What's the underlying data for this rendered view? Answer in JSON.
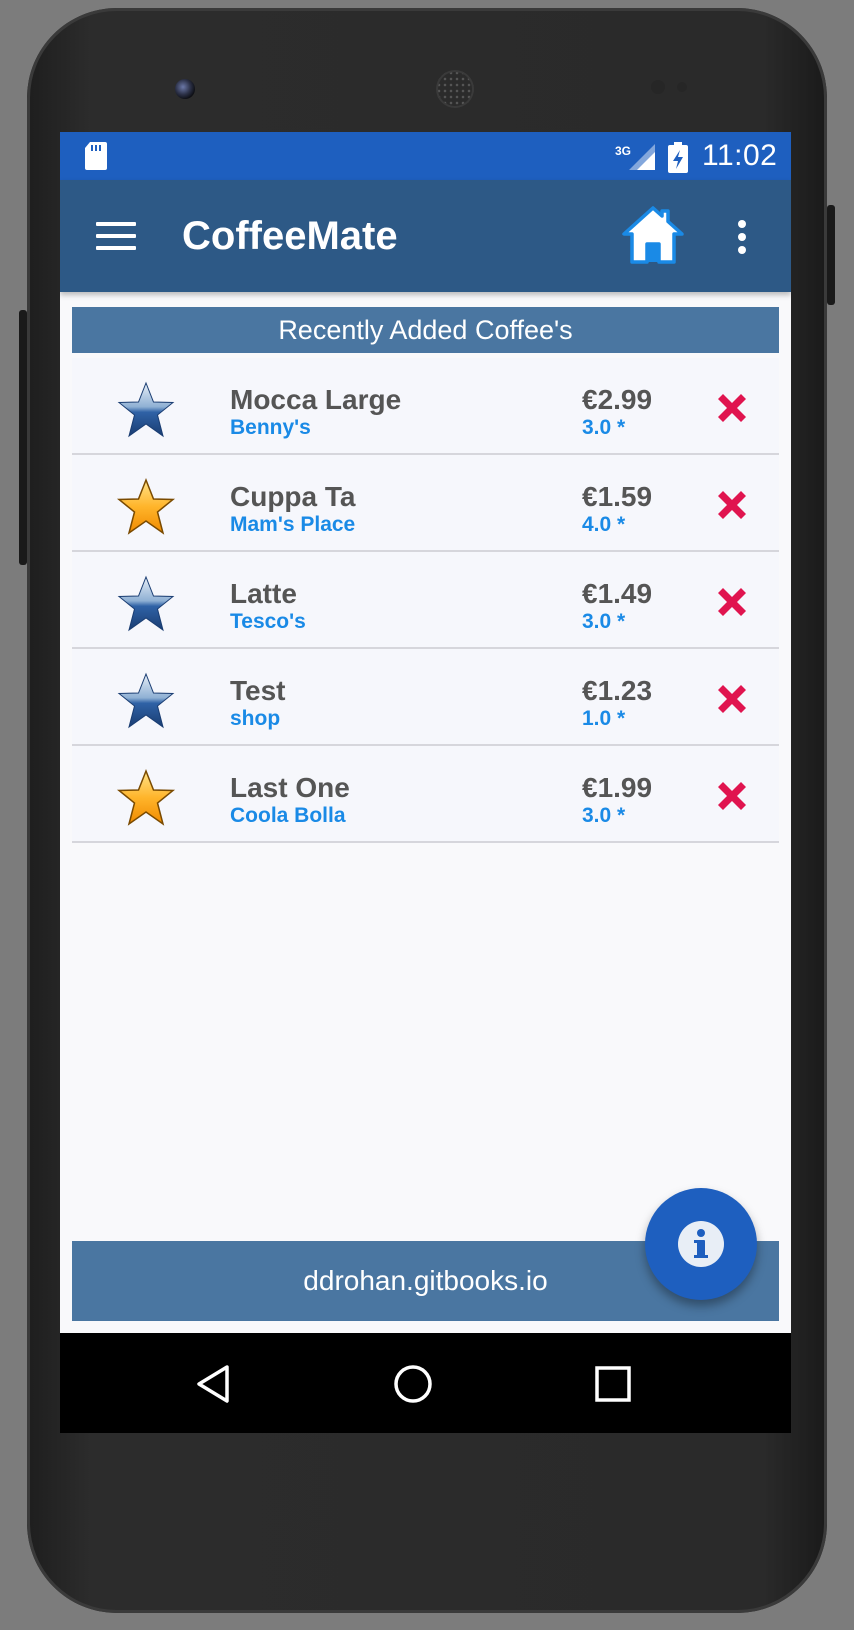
{
  "status_bar": {
    "network": "3G",
    "time": "11:02"
  },
  "app_bar": {
    "title": "CoffeeMate",
    "menu_icon": "hamburger-menu-icon",
    "home_icon": "home-icon",
    "overflow_icon": "more-vert-icon"
  },
  "section": {
    "title": "Recently Added Coffee's"
  },
  "coffees": [
    {
      "name": "Mocca Large",
      "shop": "Benny's",
      "price": "€2.99",
      "rating": "3.0 *",
      "favourite": false
    },
    {
      "name": "Cuppa Ta",
      "shop": "Mam's Place",
      "price": "€1.59",
      "rating": "4.0 *",
      "favourite": true
    },
    {
      "name": "Latte",
      "shop": "Tesco's",
      "price": "€1.49",
      "rating": "3.0 *",
      "favourite": false
    },
    {
      "name": "Test",
      "shop": "shop",
      "price": "€1.23",
      "rating": "1.0 *",
      "favourite": false
    },
    {
      "name": "Last One",
      "shop": "Coola Bolla",
      "price": "€1.99",
      "rating": "3.0 *",
      "favourite": true
    }
  ],
  "footer": {
    "text": "ddrohan.gitbooks.io"
  },
  "fab": {
    "icon": "info-icon"
  },
  "nav": {
    "back": "back-icon",
    "home": "home-circle-icon",
    "recents": "recents-icon"
  },
  "colors": {
    "status_bar": "#1e5fbf",
    "app_bar": "#2d5986",
    "section_header": "#4a76a1",
    "accent_text": "#1a8ae6",
    "delete": "#e0144f",
    "fab": "#1e5fbf"
  }
}
